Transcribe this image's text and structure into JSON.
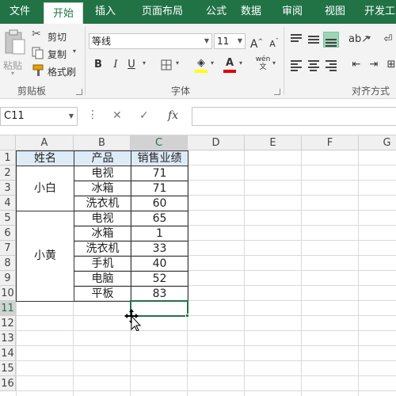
{
  "tabs": [
    {
      "label": "文件"
    },
    {
      "label": "开始"
    },
    {
      "label": "插入"
    },
    {
      "label": "页面布局"
    },
    {
      "label": "公式"
    },
    {
      "label": "数据"
    },
    {
      "label": "审阅"
    },
    {
      "label": "视图"
    },
    {
      "label": "开发工"
    }
  ],
  "ribbon": {
    "clipboard": {
      "paste": "粘贴",
      "cut": "剪切",
      "copy": "复制",
      "format_painter": "格式刷",
      "group_label": "剪贴板"
    },
    "font": {
      "font_name": "等线",
      "font_size": "11",
      "bold": "B",
      "italic": "I",
      "underline": "U",
      "font_color_letter": "A",
      "group_label": "字体",
      "fill_color": "#ffff00",
      "text_color": "#e00000"
    },
    "alignment": {
      "group_label": "对齐方式"
    }
  },
  "formula_bar": {
    "name_box": "C11",
    "formula": ""
  },
  "columns": [
    "A",
    "B",
    "C",
    "D",
    "E",
    "F",
    "G"
  ],
  "rows": [
    "1",
    "2",
    "3",
    "4",
    "5",
    "6",
    "7",
    "8",
    "9",
    "10",
    "11",
    "12",
    "13",
    "14",
    "15",
    "16"
  ],
  "sheet": {
    "headers": {
      "a": "姓名",
      "b": "产品",
      "c": "销售业绩"
    },
    "groups": [
      {
        "name": "小白",
        "items": [
          {
            "product": "电视",
            "sales": "71"
          },
          {
            "product": "冰箱",
            "sales": "71"
          },
          {
            "product": "洗衣机",
            "sales": "60"
          }
        ]
      },
      {
        "name": "小黄",
        "items": [
          {
            "product": "电视",
            "sales": "65"
          },
          {
            "product": "冰箱",
            "sales": "1"
          },
          {
            "product": "洗衣机",
            "sales": "33"
          },
          {
            "product": "手机",
            "sales": "40"
          },
          {
            "product": "电脑",
            "sales": "52"
          },
          {
            "product": "平板",
            "sales": "83"
          }
        ]
      }
    ]
  },
  "colors": {
    "accent": "#217346",
    "header_fill": "#ddebf7"
  }
}
